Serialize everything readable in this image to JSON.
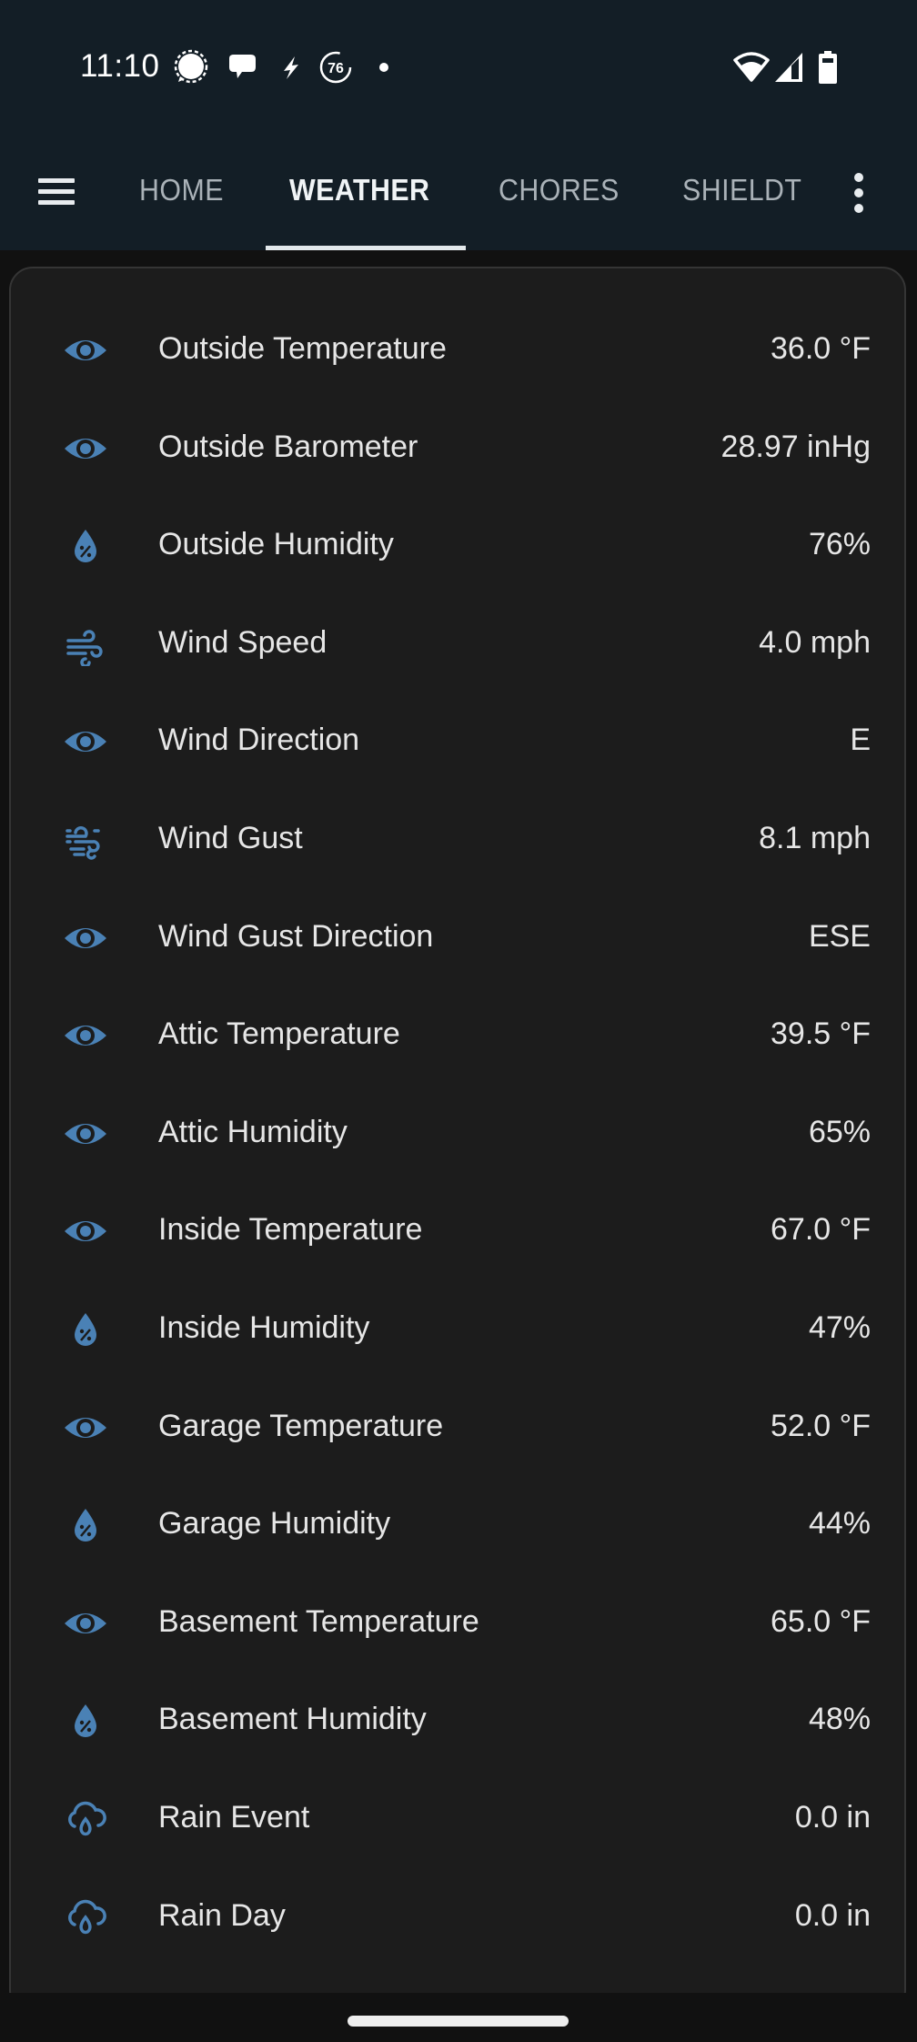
{
  "status_bar": {
    "time": "11:10",
    "notification_icons": [
      "signal-messenger-icon",
      "messages-icon",
      "bolt-icon",
      "aqi-76-icon",
      "more-dot-icon"
    ],
    "aqi_badge": "76",
    "system_icons": [
      "wifi-icon",
      "cell-signal-icon",
      "battery-icon"
    ]
  },
  "tabs": [
    {
      "label": "HOME",
      "active": false
    },
    {
      "label": "WEATHER",
      "active": true
    },
    {
      "label": "CHORES",
      "active": false
    },
    {
      "label": "SHIELDT",
      "active": false
    }
  ],
  "colors": {
    "header_bg": "#131e26",
    "card_bg": "#1c1c1c",
    "icon_accent": "#4a81b5",
    "text": "#e6e6e6"
  },
  "entities": [
    {
      "icon": "eye-icon",
      "label": "Outside Temperature",
      "value": "36.0 °F"
    },
    {
      "icon": "eye-icon",
      "label": "Outside Barometer",
      "value": "28.97 inHg"
    },
    {
      "icon": "water-percent-icon",
      "label": "Outside Humidity",
      "value": "76%"
    },
    {
      "icon": "weather-windy-icon",
      "label": "Wind Speed",
      "value": "4.0 mph"
    },
    {
      "icon": "eye-icon",
      "label": "Wind Direction",
      "value": "E"
    },
    {
      "icon": "weather-windy-variant-icon",
      "label": "Wind Gust",
      "value": "8.1 mph"
    },
    {
      "icon": "eye-icon",
      "label": "Wind Gust Direction",
      "value": "ESE"
    },
    {
      "icon": "eye-icon",
      "label": "Attic Temperature",
      "value": "39.5 °F"
    },
    {
      "icon": "eye-icon",
      "label": "Attic Humidity",
      "value": "65%"
    },
    {
      "icon": "eye-icon",
      "label": "Inside Temperature",
      "value": "67.0 °F"
    },
    {
      "icon": "water-percent-icon",
      "label": "Inside Humidity",
      "value": "47%"
    },
    {
      "icon": "eye-icon",
      "label": "Garage Temperature",
      "value": "52.0 °F"
    },
    {
      "icon": "water-percent-icon",
      "label": "Garage Humidity",
      "value": "44%"
    },
    {
      "icon": "eye-icon",
      "label": "Basement Temperature",
      "value": "65.0 °F"
    },
    {
      "icon": "water-percent-icon",
      "label": "Basement Humidity",
      "value": "48%"
    },
    {
      "icon": "weather-rain-icon",
      "label": "Rain Event",
      "value": "0.0 in"
    },
    {
      "icon": "weather-rain-icon",
      "label": "Rain Day",
      "value": "0.0 in"
    }
  ]
}
